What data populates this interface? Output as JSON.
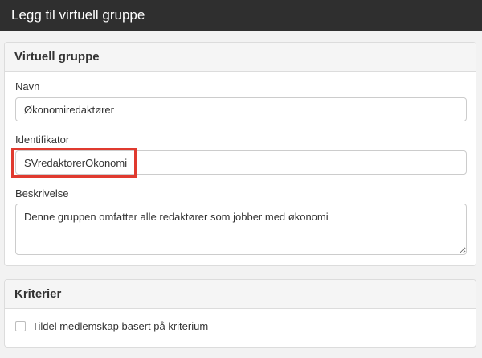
{
  "window": {
    "title": "Legg til virtuell gruppe"
  },
  "virtual_group_panel": {
    "heading": "Virtuell gruppe",
    "name_label": "Navn",
    "name_value": "Økonomiredaktører",
    "identifier_label": "Identifikator",
    "identifier_value": "SVredaktorerOkonomi",
    "description_label": "Beskrivelse",
    "description_value": "Denne gruppen omfatter alle redaktører som jobber med økonomi"
  },
  "criteria_panel": {
    "heading": "Kriterier",
    "checkbox_label": "Tildel medlemskap basert på kriterium",
    "checkbox_checked": false
  },
  "colors": {
    "titlebar_bg": "#2f2f2f",
    "highlight": "#e03a2f",
    "panel_heading_bg": "#f5f5f5"
  }
}
